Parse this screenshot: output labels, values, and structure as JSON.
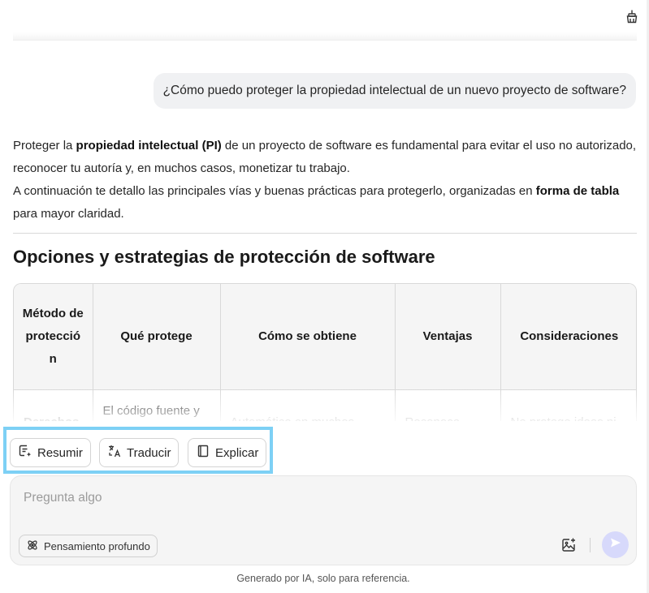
{
  "user_message": "¿Cómo puedo proteger la propiedad intelectual de un nuevo proyecto de software?",
  "answer": {
    "p1_a": "Proteger la ",
    "p1_b": "propiedad intelectual (PI)",
    "p1_c": " de un proyecto de software es fundamental para evitar el uso no autorizado, reconocer tu autoría y, en muchos casos, monetizar tu trabajo.",
    "p2_a": "A continuación te detallo las principales vías y buenas prácticas para protegerlo, organizadas en ",
    "p2_b": "forma de tabla",
    "p2_c": " para mayor claridad."
  },
  "section_title": "Opciones y estrategias de protección de software",
  "table": {
    "headers": [
      "Método de protecció n",
      "Qué protege",
      "Cómo se obtiene",
      "Ventajas",
      "Consideraciones"
    ],
    "row1": [
      "Derechos",
      "El código fuente y",
      "Automático en muchos",
      "Reconoce",
      "No protege ideas ni"
    ]
  },
  "quick_actions": {
    "summarize": "Resumir",
    "translate": "Traducir",
    "explain": "Explicar"
  },
  "input": {
    "placeholder": "Pregunta algo",
    "deep_thinking_label": "Pensamiento profundo"
  },
  "disclaimer": "Generado por IA, solo para referencia.",
  "colors": {
    "highlight_border": "#7dd0f5",
    "send_button": "#d7d9fb",
    "user_bubble": "#f0f1f3"
  },
  "icons": [
    "broom-icon",
    "summary-icon",
    "translate-icon",
    "book-icon",
    "atom-icon",
    "image-add-icon",
    "send-icon"
  ]
}
